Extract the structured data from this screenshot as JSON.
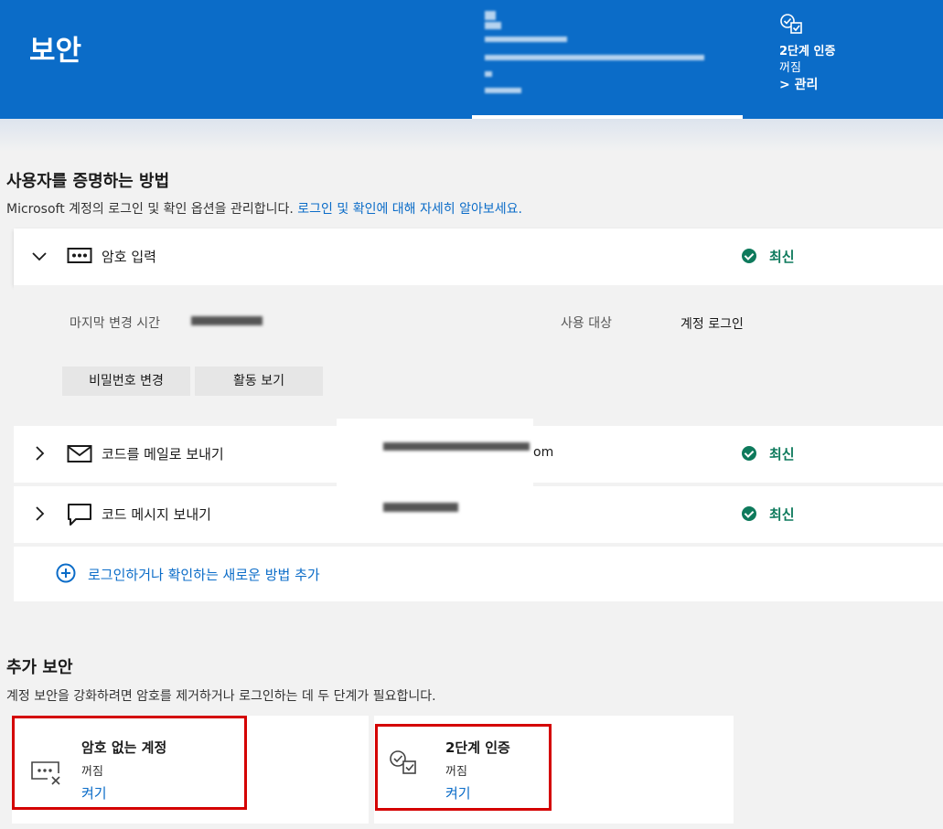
{
  "header": {
    "title": "보안",
    "two_step": {
      "title": "2단계 인증",
      "state": "꺼짐",
      "manage": "> 관리"
    },
    "color": "#0b6cc8"
  },
  "methods": {
    "title": "사용자를 증명하는 방법",
    "description": "Microsoft 계정의 로그인 및 확인 옵션을 관리합니다.",
    "learn_more": "로그인 및 확인에 대해 자세히 알아보세요.",
    "rows": [
      {
        "label": "암호 입력",
        "status": "최신",
        "expanded": true,
        "icon": "password-dots-icon"
      },
      {
        "label": "코드를 메일로 보내기",
        "status": "최신",
        "detail_suffix": "om",
        "icon": "mail-icon"
      },
      {
        "label": "코드 메시지 보내기",
        "status": "최신",
        "icon": "chat-bubble-icon"
      }
    ],
    "expanded_detail": {
      "last_changed_label": "마지막 변경 시간",
      "usage_label": "사용 대상",
      "usage_value": "계정 로그인",
      "change_password_button": "비밀번호 변경",
      "view_activity_button": "활동 보기"
    },
    "add_method": "로그인하거나 확인하는 새로운 방법 추가"
  },
  "extra": {
    "title": "추가 보안",
    "description": "계정 보안을 강화하려면 암호를 제거하거나 로그인하는 데 두 단계가 필요합니다.",
    "cards": [
      {
        "title": "암호 없는 계정",
        "state": "꺼짐",
        "action": "켜기",
        "icon": "password-remove-icon"
      },
      {
        "title": "2단계 인증",
        "state": "꺼짐",
        "action": "켜기",
        "icon": "two-step-check-icon"
      }
    ]
  },
  "status_color": "#0e7a5c",
  "highlight_color": "#d40000"
}
